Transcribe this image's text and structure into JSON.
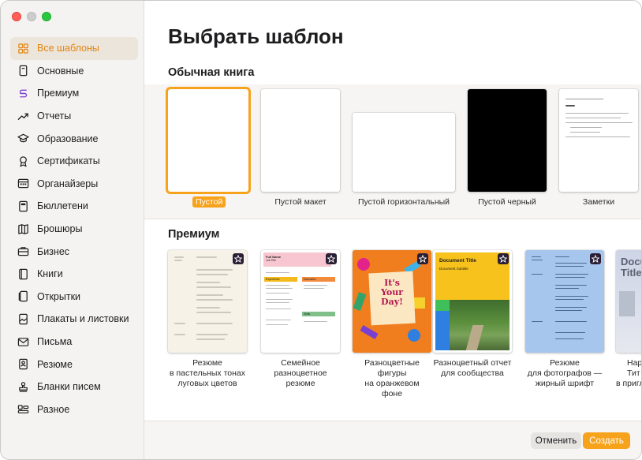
{
  "window": {
    "controls": [
      "close",
      "minimize",
      "zoom"
    ]
  },
  "sidebar": {
    "items": [
      {
        "label": "Все шаблоны",
        "icon": "grid-icon",
        "active": true
      },
      {
        "label": "Основные",
        "icon": "document-icon"
      },
      {
        "label": "Премиум",
        "icon": "premium-icon"
      },
      {
        "label": "Отчеты",
        "icon": "trend-chart-icon"
      },
      {
        "label": "Образование",
        "icon": "graduation-cap-icon"
      },
      {
        "label": "Сертификаты",
        "icon": "award-ribbon-icon"
      },
      {
        "label": "Органайзеры",
        "icon": "calendar-grid-icon"
      },
      {
        "label": "Бюллетени",
        "icon": "newspaper-icon"
      },
      {
        "label": "Брошюры",
        "icon": "brochure-icon"
      },
      {
        "label": "Бизнес",
        "icon": "briefcase-icon"
      },
      {
        "label": "Книги",
        "icon": "book-icon"
      },
      {
        "label": "Открытки",
        "icon": "card-icon"
      },
      {
        "label": "Плакаты и листовки",
        "icon": "poster-icon"
      },
      {
        "label": "Письма",
        "icon": "letter-icon"
      },
      {
        "label": "Резюме",
        "icon": "person-badge-icon"
      },
      {
        "label": "Бланки писем",
        "icon": "stamp-icon"
      },
      {
        "label": "Разное",
        "icon": "misc-blocks-icon"
      }
    ]
  },
  "main": {
    "title": "Выбрать шаблон",
    "section_basic": {
      "title": "Обычная книга",
      "templates": [
        {
          "label": "Пустой",
          "selected": true
        },
        {
          "label": "Пустой макет"
        },
        {
          "label": "Пустой горизонтальный"
        },
        {
          "label": "Пустой черный"
        },
        {
          "label": "Заметки"
        }
      ]
    },
    "section_premium": {
      "title": "Премиум",
      "templates": [
        {
          "label_lines": [
            "Резюме",
            "в пастельных тонах",
            "луговых цветов"
          ]
        },
        {
          "label_lines": [
            "Семейное",
            "разноцветное",
            "резюме"
          ]
        },
        {
          "label_lines": [
            "Разноцветные",
            "фигуры",
            "на оранжевом",
            "фоне"
          ]
        },
        {
          "label_lines": [
            "Разноцветный отчет",
            "для сообщества"
          ]
        },
        {
          "label_lines": [
            "Резюме",
            "для фотографов —",
            "жирный шрифт"
          ]
        },
        {
          "label_lines": [
            "Нар",
            "Тит",
            "в пригл"
          ]
        }
      ],
      "thumb_text": {
        "family_name": "Full Name",
        "family_title": "Job Title",
        "family_h1": "Experience",
        "family_h2": "Education",
        "family_h3": "Skills",
        "poster": [
          "It's",
          "Your",
          "Day!"
        ],
        "report_title": "Document Title",
        "report_subtitle": "Document Subtitle",
        "cut_title": [
          "Documen",
          "Title"
        ]
      }
    }
  },
  "footer": {
    "cancel_label": "Отменить",
    "create_label": "Создать"
  },
  "colors": {
    "accent": "#f7a21b",
    "active_sidebar_text": "#e3850f",
    "sidebar_bg": "#f4f3f1"
  }
}
